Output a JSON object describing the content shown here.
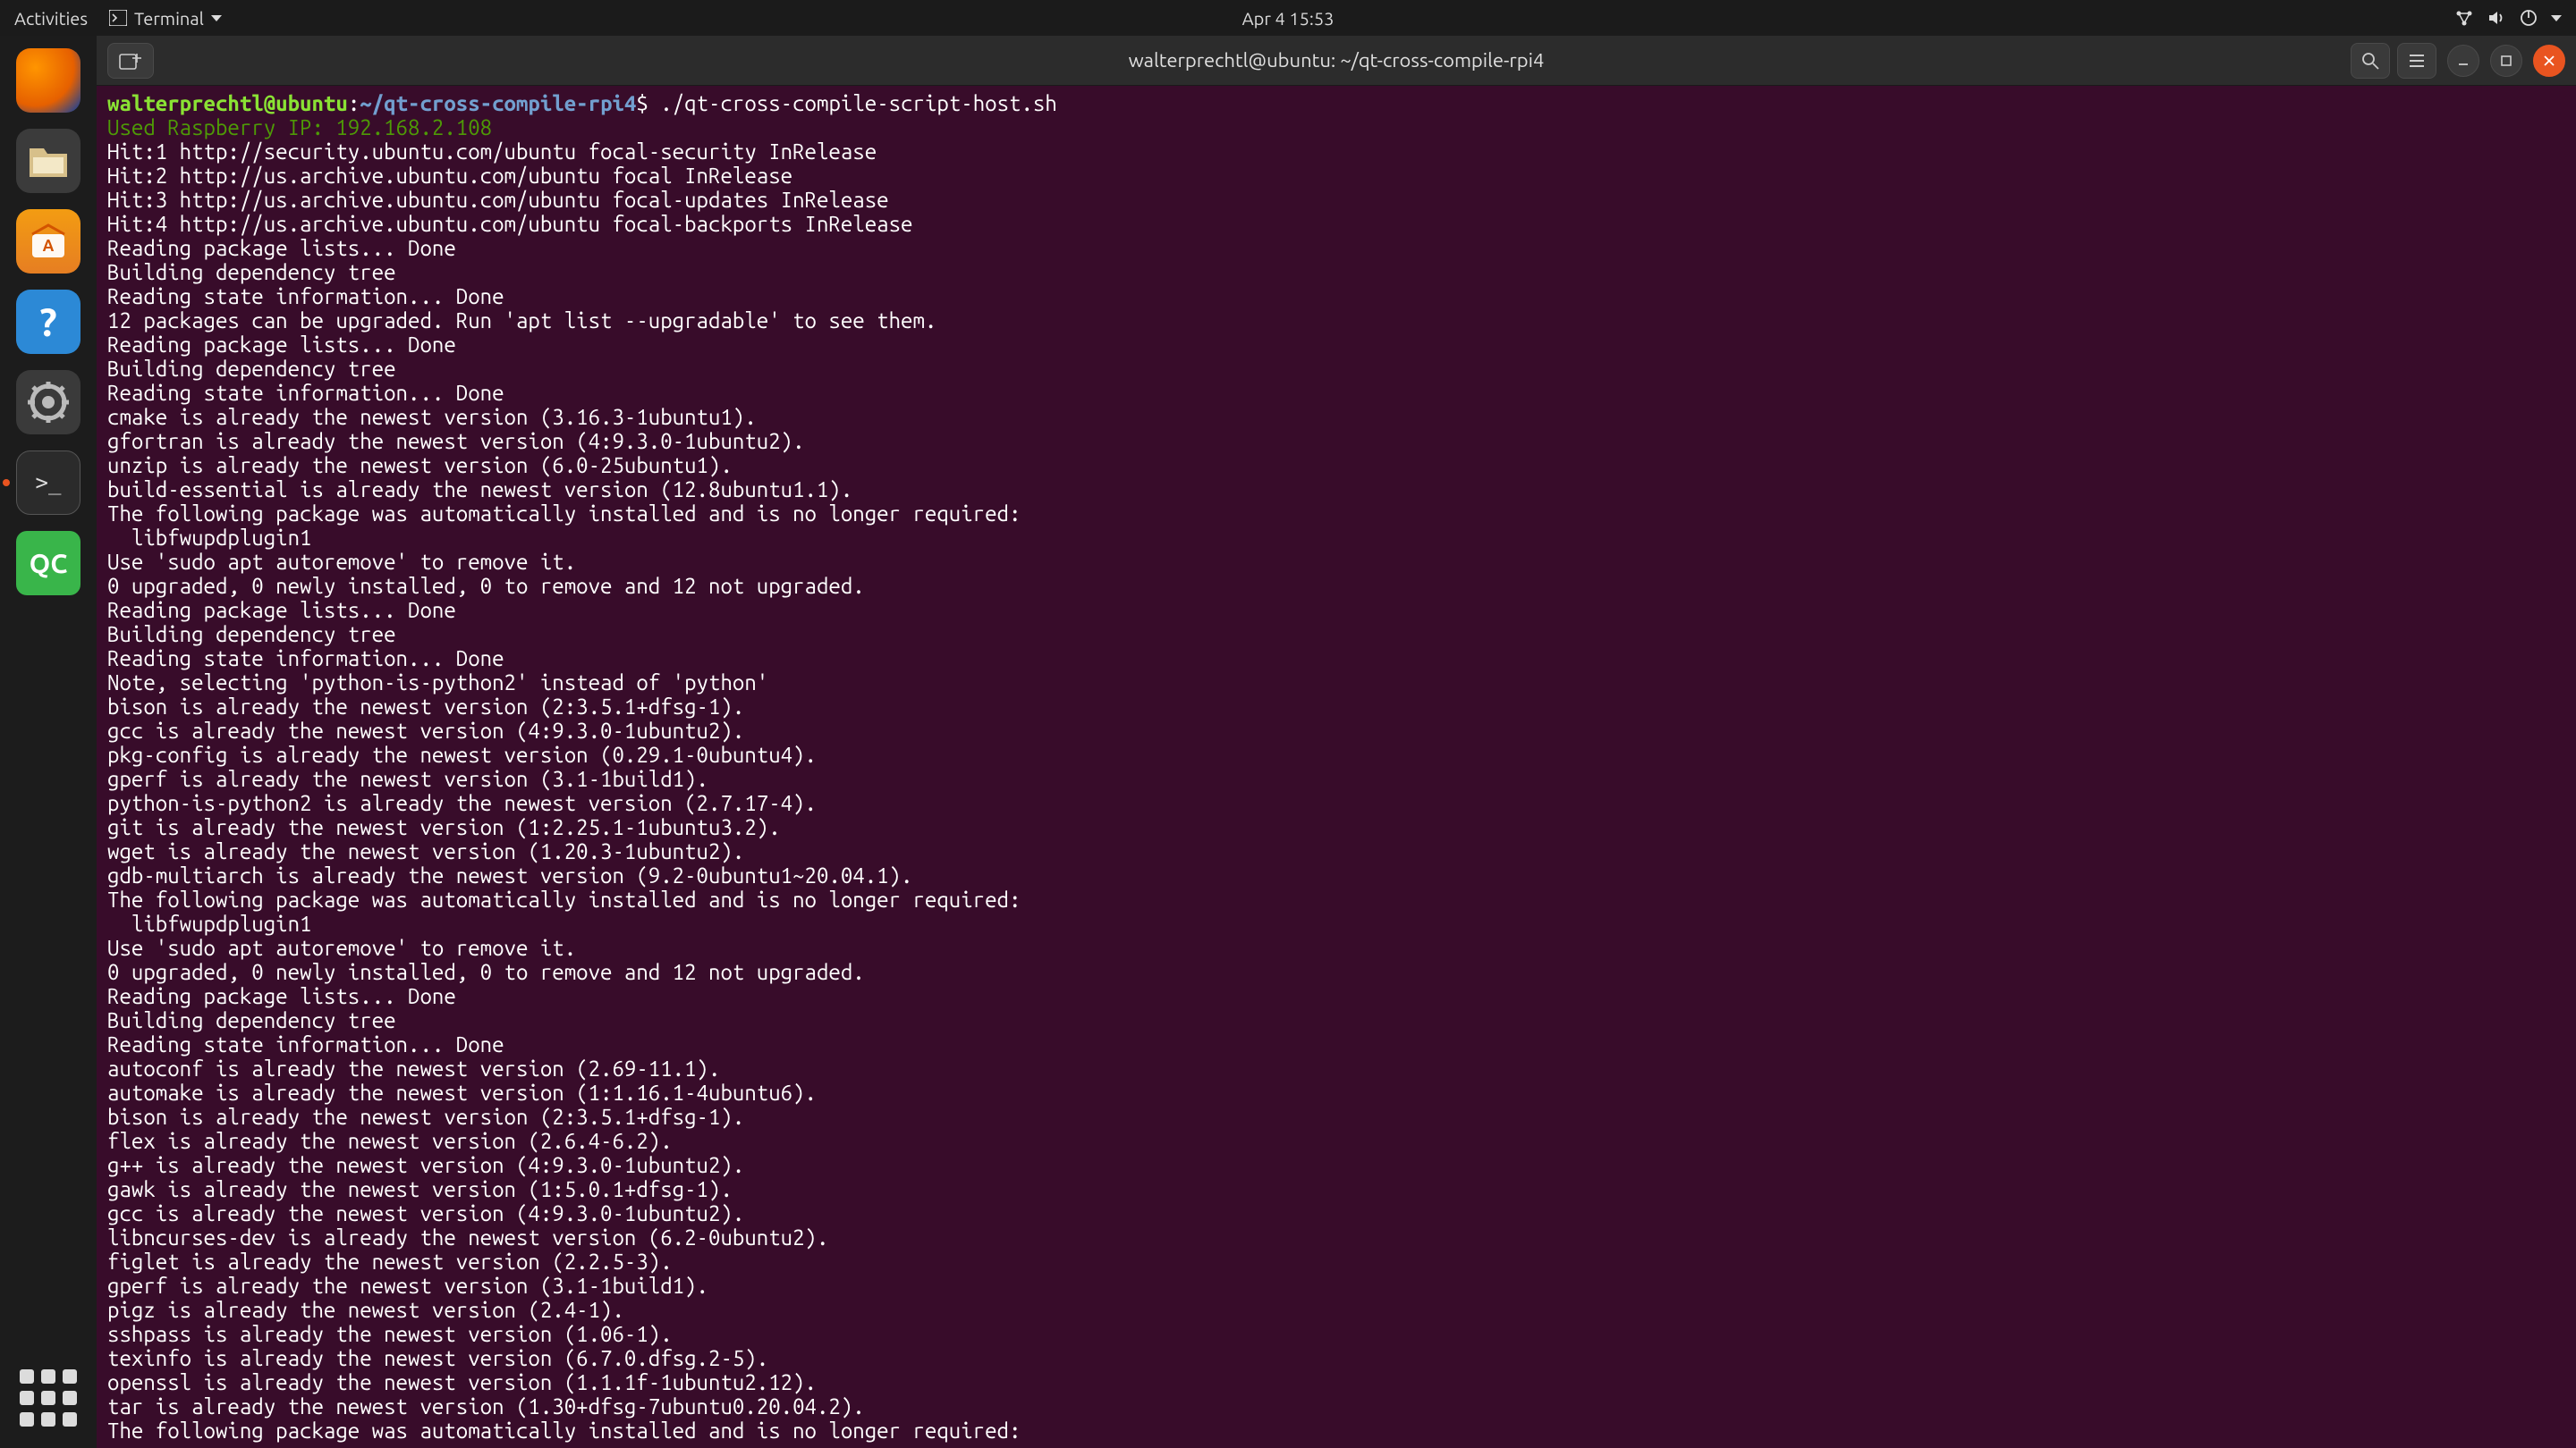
{
  "topbar": {
    "activities": "Activities",
    "app_menu": "Terminal",
    "clock": "Apr 4  15:53"
  },
  "dock": {
    "help_glyph": "?",
    "qc_label": "QC",
    "terminal_prompt_glyph": ">_"
  },
  "window": {
    "title": "walterprechtl@ubuntu: ~/qt-cross-compile-rpi4"
  },
  "prompt": {
    "user_host": "walterprechtl@ubuntu",
    "colon": ":",
    "path": "~/qt-cross-compile-rpi4",
    "dollar": "$ ",
    "command": "./qt-cross-compile-script-host.sh"
  },
  "rpi_line": "Used Raspberry IP: 192.168.2.108",
  "output_lines": [
    "Hit:1 http://security.ubuntu.com/ubuntu focal-security InRelease",
    "Hit:2 http://us.archive.ubuntu.com/ubuntu focal InRelease",
    "Hit:3 http://us.archive.ubuntu.com/ubuntu focal-updates InRelease",
    "Hit:4 http://us.archive.ubuntu.com/ubuntu focal-backports InRelease",
    "Reading package lists... Done",
    "Building dependency tree",
    "Reading state information... Done",
    "12 packages can be upgraded. Run 'apt list --upgradable' to see them.",
    "Reading package lists... Done",
    "Building dependency tree",
    "Reading state information... Done",
    "cmake is already the newest version (3.16.3-1ubuntu1).",
    "gfortran is already the newest version (4:9.3.0-1ubuntu2).",
    "unzip is already the newest version (6.0-25ubuntu1).",
    "build-essential is already the newest version (12.8ubuntu1.1).",
    "The following package was automatically installed and is no longer required:",
    "  libfwupdplugin1",
    "Use 'sudo apt autoremove' to remove it.",
    "0 upgraded, 0 newly installed, 0 to remove and 12 not upgraded.",
    "Reading package lists... Done",
    "Building dependency tree",
    "Reading state information... Done",
    "Note, selecting 'python-is-python2' instead of 'python'",
    "bison is already the newest version (2:3.5.1+dfsg-1).",
    "gcc is already the newest version (4:9.3.0-1ubuntu2).",
    "pkg-config is already the newest version (0.29.1-0ubuntu4).",
    "gperf is already the newest version (3.1-1build1).",
    "python-is-python2 is already the newest version (2.7.17-4).",
    "git is already the newest version (1:2.25.1-1ubuntu3.2).",
    "wget is already the newest version (1.20.3-1ubuntu2).",
    "gdb-multiarch is already the newest version (9.2-0ubuntu1~20.04.1).",
    "The following package was automatically installed and is no longer required:",
    "  libfwupdplugin1",
    "Use 'sudo apt autoremove' to remove it.",
    "0 upgraded, 0 newly installed, 0 to remove and 12 not upgraded.",
    "Reading package lists... Done",
    "Building dependency tree",
    "Reading state information... Done",
    "autoconf is already the newest version (2.69-11.1).",
    "automake is already the newest version (1:1.16.1-4ubuntu6).",
    "bison is already the newest version (2:3.5.1+dfsg-1).",
    "flex is already the newest version (2.6.4-6.2).",
    "g++ is already the newest version (4:9.3.0-1ubuntu2).",
    "gawk is already the newest version (1:5.0.1+dfsg-1).",
    "gcc is already the newest version (4:9.3.0-1ubuntu2).",
    "libncurses-dev is already the newest version (6.2-0ubuntu2).",
    "figlet is already the newest version (2.2.5-3).",
    "gperf is already the newest version (3.1-1build1).",
    "pigz is already the newest version (2.4-1).",
    "sshpass is already the newest version (1.06-1).",
    "texinfo is already the newest version (6.7.0.dfsg.2-5).",
    "openssl is already the newest version (1.1.1f-1ubuntu2.12).",
    "tar is already the newest version (1.30+dfsg-7ubuntu0.20.04.2).",
    "The following package was automatically installed and is no longer required:"
  ]
}
